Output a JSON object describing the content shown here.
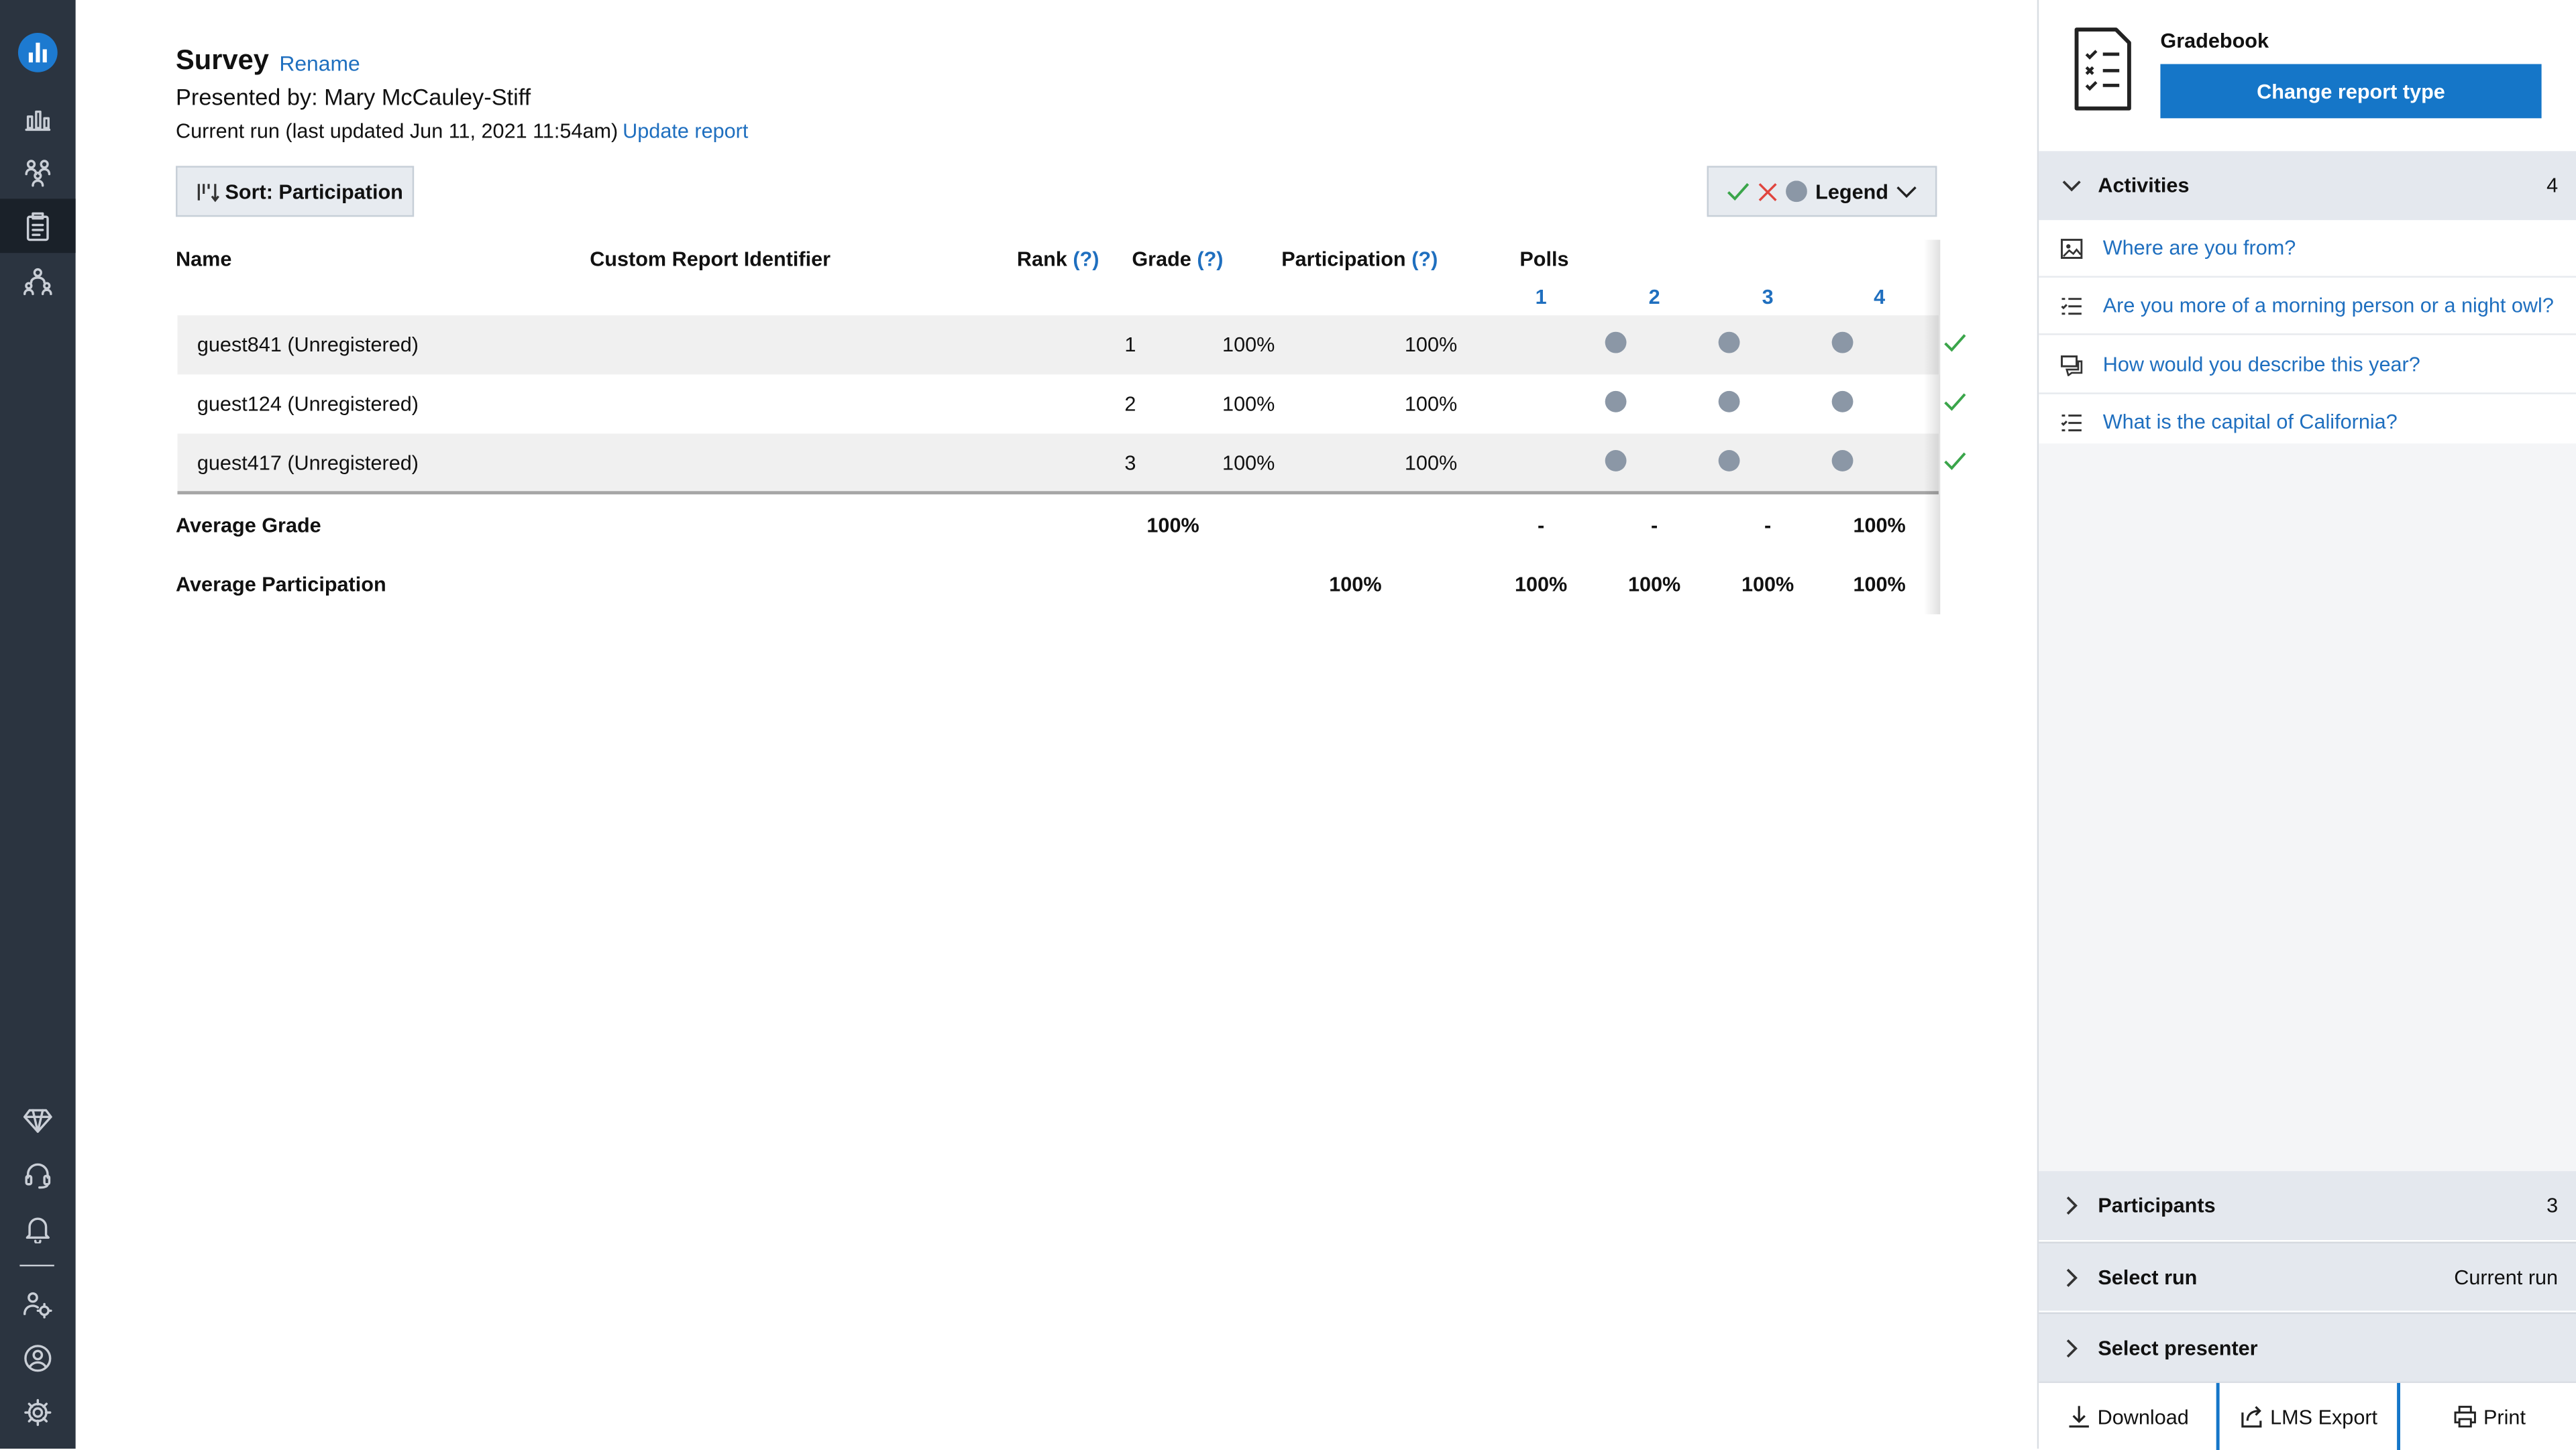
{
  "report": {
    "title": "Survey",
    "rename_label": "Rename",
    "presented_by": "Presented by: Mary McCauley-Stiff",
    "current_run": "Current run (last updated Jun 11, 2021 11:54am)",
    "update_label": "Update report"
  },
  "toolbar": {
    "sort_label": "Sort: Participation",
    "legend_label": "Legend"
  },
  "table": {
    "headers": {
      "name": "Name",
      "custom_id": "Custom Report Identifier",
      "rank": "Rank",
      "grade": "Grade",
      "participation": "Participation",
      "polls": "Polls",
      "help": "(?)"
    },
    "poll_numbers": [
      "1",
      "2",
      "3",
      "4"
    ],
    "rows": [
      {
        "name": "guest841 (Unregistered)",
        "rank": "1",
        "grade": "100%",
        "participation": "100%",
        "polls": [
          "dot",
          "dot",
          "dot",
          "check"
        ]
      },
      {
        "name": "guest124 (Unregistered)",
        "rank": "2",
        "grade": "100%",
        "participation": "100%",
        "polls": [
          "dot",
          "dot",
          "dot",
          "check"
        ]
      },
      {
        "name": "guest417 (Unregistered)",
        "rank": "3",
        "grade": "100%",
        "participation": "100%",
        "polls": [
          "dot",
          "dot",
          "dot",
          "check"
        ]
      }
    ],
    "average_grade": {
      "label": "Average Grade",
      "grade": "100%",
      "polls": [
        "-",
        "-",
        "-",
        "100%"
      ]
    },
    "average_participation": {
      "label": "Average Participation",
      "participation": "100%",
      "polls": [
        "100%",
        "100%",
        "100%",
        "100%"
      ]
    }
  },
  "panel": {
    "report_type": "Gradebook",
    "change_label": "Change report type",
    "activities": {
      "label": "Activities",
      "count": "4",
      "items": [
        {
          "label": "Where are you from?",
          "icon": "image-poll-icon"
        },
        {
          "label": "Are you more of a morning person or a night owl?",
          "icon": "multiple-choice-icon"
        },
        {
          "label": "How would you describe this year?",
          "icon": "open-ended-icon"
        },
        {
          "label": "What is the capital of California?",
          "icon": "multiple-choice-icon"
        }
      ]
    },
    "participants": {
      "label": "Participants",
      "count": "3"
    },
    "select_run": {
      "label": "Select run",
      "value": "Current run"
    },
    "select_presenter": {
      "label": "Select presenter"
    },
    "footer": {
      "download": "Download",
      "lms_export": "LMS Export",
      "print": "Print"
    }
  },
  "colors": {
    "accent": "#1576c8",
    "link": "#1f6fbf",
    "rail": "#2b3440",
    "check": "#3aa54a",
    "cross": "#e0453f",
    "dot": "#8b97a6"
  }
}
